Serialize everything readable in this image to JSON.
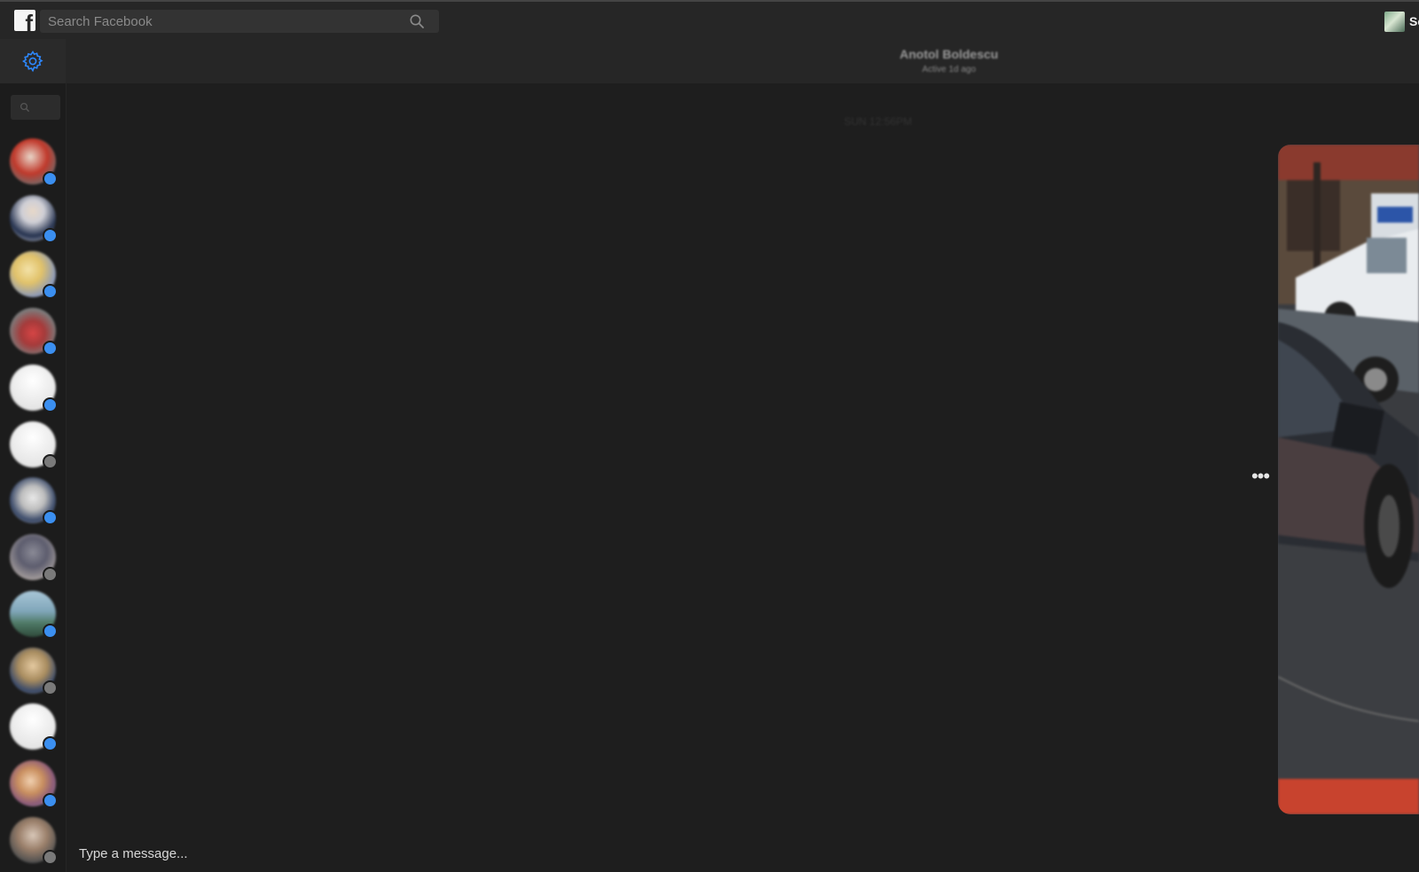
{
  "topbar": {
    "logo_icon": "facebook-f-icon",
    "search_placeholder": "Search Facebook",
    "search_icon": "search-icon",
    "profile_name": "Se"
  },
  "sidebar": {
    "settings_icon": "gear-icon",
    "settings_color": "#2d88ff",
    "search_icon": "search-icon",
    "contacts": [
      {
        "status": "online"
      },
      {
        "status": "online"
      },
      {
        "status": "online"
      },
      {
        "status": "online"
      },
      {
        "status": "online"
      },
      {
        "status": "idle"
      },
      {
        "status": "online"
      },
      {
        "status": "idle"
      },
      {
        "status": "online"
      },
      {
        "status": "idle"
      },
      {
        "status": "online"
      },
      {
        "status": "online"
      },
      {
        "status": "idle"
      }
    ]
  },
  "conversation": {
    "name": "Anotol Boldescu",
    "status": "Active 1d ago",
    "timestamp": "SUN 12:56PM",
    "more_icon": "more-horizontal-icon",
    "message_placeholder": "Type a message..."
  },
  "colors": {
    "online": "#3b8ff0",
    "idle": "#7a7a7a",
    "background": "#1e1e1e"
  }
}
